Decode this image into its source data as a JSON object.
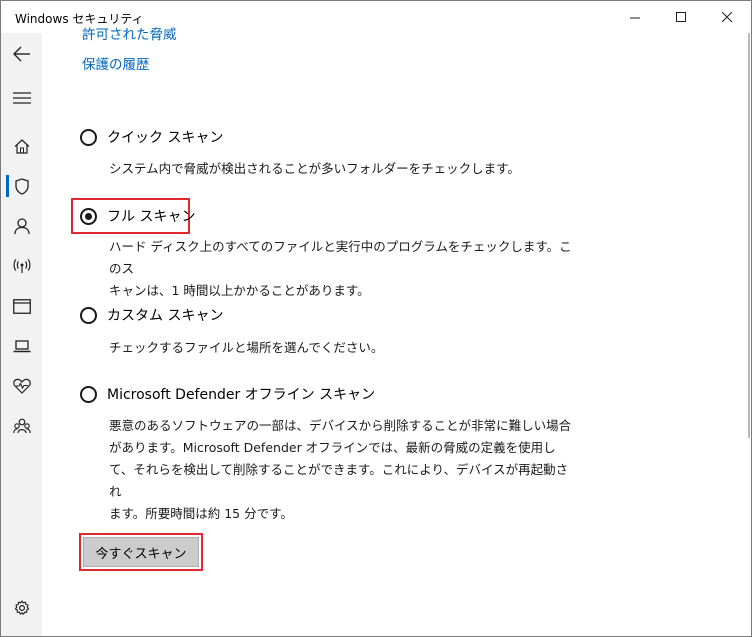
{
  "window": {
    "title": "Windows セキュリティ",
    "minimize_glyph": "—",
    "maximize_glyph": "☐",
    "close_glyph": "✕"
  },
  "nav": {
    "items": [
      {
        "name": "back-arrow-icon"
      },
      {
        "name": "hamburger-menu-icon"
      },
      {
        "name": "home-icon"
      },
      {
        "name": "shield-icon",
        "selected": true
      },
      {
        "name": "person-icon"
      },
      {
        "name": "wireless-icon"
      },
      {
        "name": "app-browser-icon"
      },
      {
        "name": "laptop-icon"
      },
      {
        "name": "heart-health-icon"
      },
      {
        "name": "family-icon"
      },
      {
        "name": "settings-gear-icon"
      }
    ]
  },
  "links": {
    "allowed_threats": "許可された脅威",
    "protection_history": "保護の履歴"
  },
  "scan_options": [
    {
      "label": "クイック スキャン",
      "checked": false,
      "description": "システム内で脅威が検出されることが多いフォルダーをチェックします。"
    },
    {
      "label": "フル スキャン",
      "checked": true,
      "description_line1": "ハード ディスク上のすべてのファイルと実行中のプログラムをチェックします。このス",
      "description_line2": "キャンは、1 時間以上かかることがあります。"
    },
    {
      "label": "カスタム スキャン",
      "checked": false,
      "description": "チェックするファイルと場所を選んでください。"
    },
    {
      "label": "Microsoft Defender オフライン スキャン",
      "checked": false,
      "description_line1": "悪意のあるソフトウェアの一部は、デバイスから削除することが非常に難しい場合",
      "description_line2": "があります。Microsoft Defender オフラインでは、最新の脅威の定義を使用し",
      "description_line3": "て、それらを検出して削除することができます。これにより、デバイスが再起動され",
      "description_line4": "ます。所要時間は約 15 分です。"
    }
  ],
  "scan_now_button": "今すぐスキャン",
  "colors": {
    "accent": "#0067c0",
    "highlight": "#e0262e",
    "rail_bg": "#f2f2f2",
    "button_bg": "#cccccc"
  }
}
